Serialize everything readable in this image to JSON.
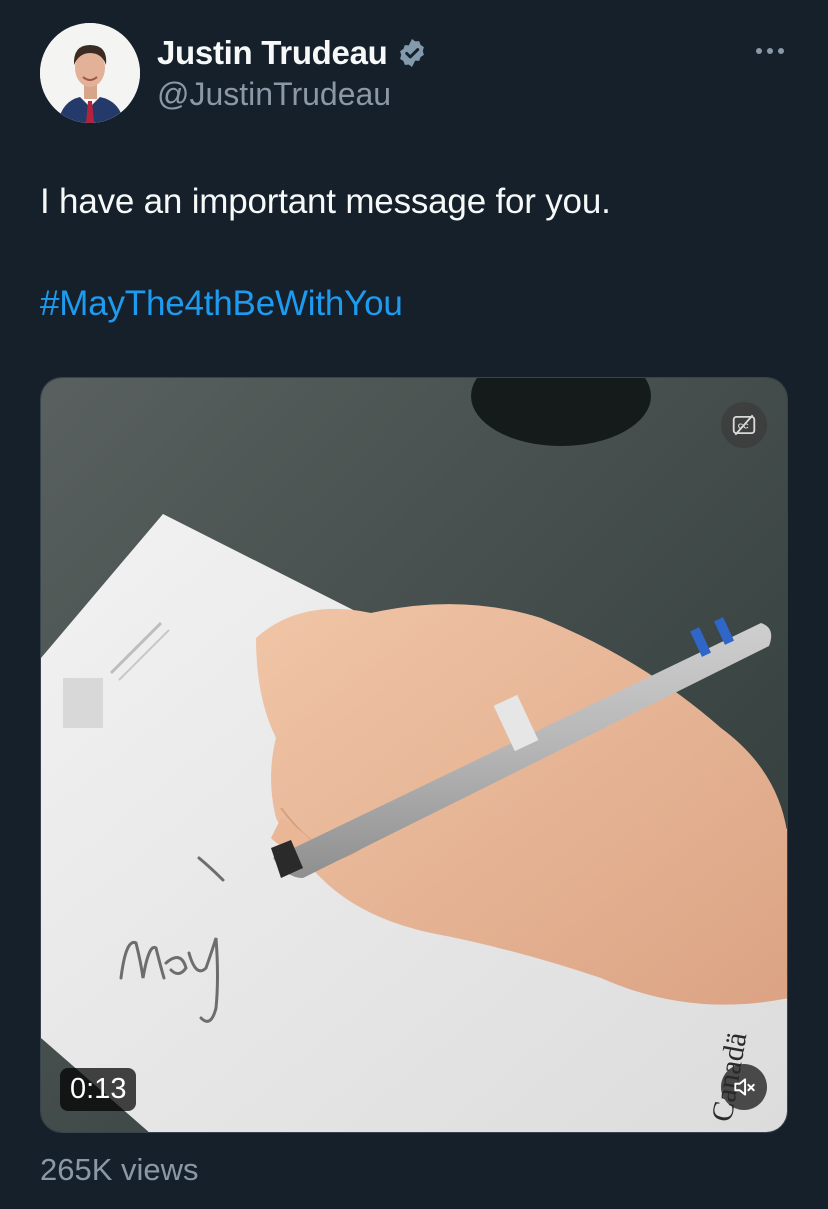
{
  "author": {
    "display_name": "Justin Trudeau",
    "handle": "@JustinTrudeau",
    "verified_icon": "verified-badge-icon",
    "avatar": "profile-photo"
  },
  "tweet": {
    "text": "I have an important message for you.",
    "hashtag": "#MayThe4thBeWithYou"
  },
  "media": {
    "type": "video",
    "duration": "0:13",
    "handwriting": "May",
    "wordmark": "Canadä",
    "icons": {
      "captions": "captions-off-icon",
      "sound": "sound-muted-icon"
    }
  },
  "stats": {
    "views": "265K views"
  },
  "colors": {
    "background": "#15202b",
    "primary_text": "#f7f9f9",
    "secondary_text": "#8b98a5",
    "link": "#1d9bf0"
  }
}
